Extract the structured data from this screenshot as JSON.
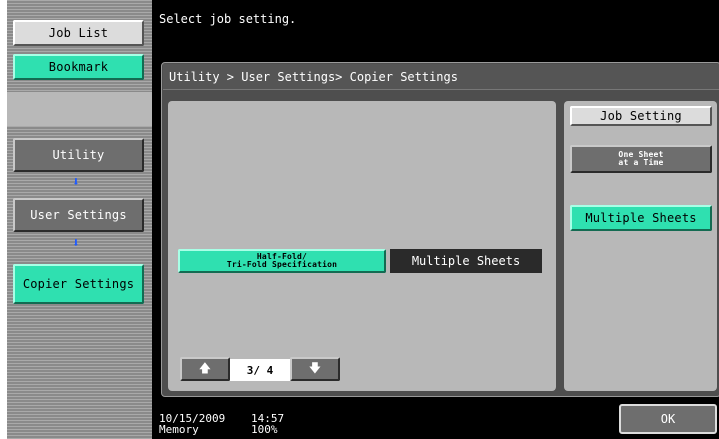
{
  "sidebar": {
    "job_list": "Job List",
    "bookmark": "Bookmark",
    "breadcrumb": [
      "Utility",
      "User Settings",
      "Copier Settings"
    ]
  },
  "message": "Select job setting.",
  "window": {
    "path": "Utility > User Settings> Copier Settings"
  },
  "setting": {
    "name": "Half-Fold/\nTri-Fold Specification",
    "value": "Multiple Sheets"
  },
  "pager": {
    "page": "3/ 4"
  },
  "job_setting": {
    "title": "Job Setting",
    "options": [
      "One Sheet\nat a Time",
      "Multiple Sheets"
    ],
    "selected": "Multiple Sheets"
  },
  "footer": {
    "date": "10/15/2009",
    "time": "14:57",
    "memory_label": "Memory",
    "memory_value": "100%"
  },
  "ok": "OK",
  "colors": {
    "accent": "#2fe0b0",
    "arrow": "#1f5bff",
    "background": "#000000"
  },
  "icons": {
    "up": "arrow-up-icon",
    "down": "arrow-down-icon"
  }
}
